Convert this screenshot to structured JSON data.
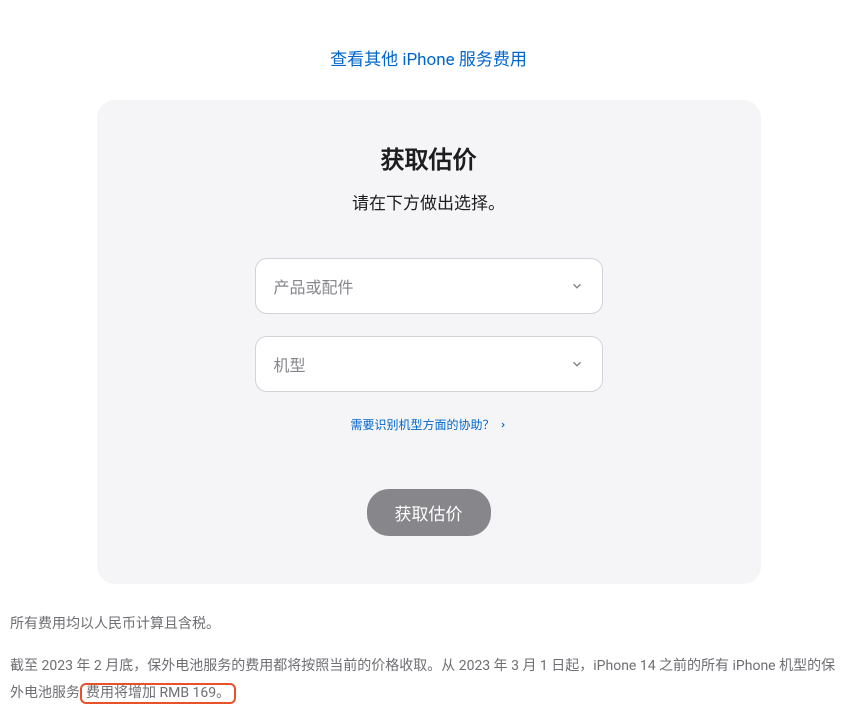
{
  "topLink": "查看其他 iPhone 服务费用",
  "card": {
    "title": "获取估价",
    "subtitle": "请在下方做出选择。",
    "select1_placeholder": "产品或配件",
    "select2_placeholder": "机型",
    "help_link": "需要识别机型方面的协助？",
    "submit": "获取估价"
  },
  "footer": {
    "line1": "所有费用均以人民币计算且含税。",
    "line2_part1": "截至 2023 年 2 月底，保外电池服务的费用都将按照当前的价格收取。从 2023 年 3 月 1 日起，iPhone 14 之前的所有 iPhone 机型的保外电池服务",
    "line2_highlight": "费用将增加 RMB 169。"
  }
}
